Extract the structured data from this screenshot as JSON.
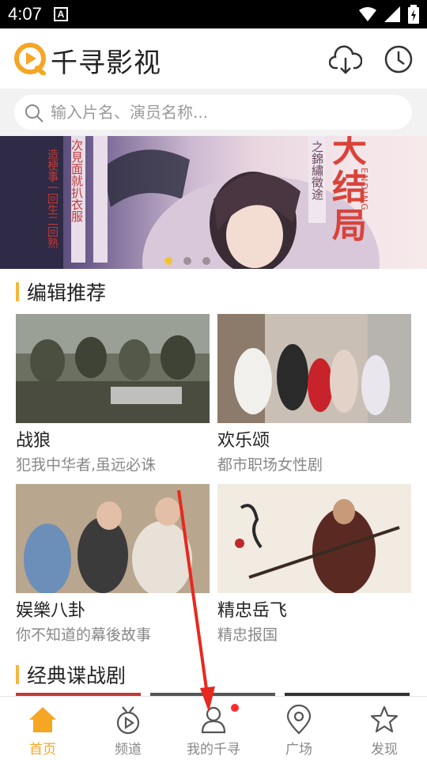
{
  "status_bar": {
    "time": "4:07",
    "notification_icon": "A"
  },
  "header": {
    "title": "千寻影视",
    "icons": [
      "logo-icon",
      "cloud-download-icon",
      "clock-icon"
    ]
  },
  "search": {
    "placeholder": "输入片名、演员名称..."
  },
  "banner": {
    "slides": 3,
    "active_slide": 1,
    "texts": [
      "大结局",
      "ENDING",
      "之錦繡徵途",
      "次見面就扒衣服",
      "造梗事一回生二回熟"
    ]
  },
  "sections": [
    {
      "title": "编辑推荐",
      "items": [
        {
          "title": "战狼",
          "subtitle": "犯我中华者,虽远必诛"
        },
        {
          "title": "欢乐颂",
          "subtitle": "都市职场女性剧"
        },
        {
          "title": "娱樂八卦",
          "subtitle": "你不知道的幕後故事"
        },
        {
          "title": "精忠岳飞",
          "subtitle": "精忠报国"
        }
      ]
    },
    {
      "title": "经典谍战剧"
    }
  ],
  "bottom_nav": [
    {
      "label": "首页",
      "icon": "home-icon",
      "active": true
    },
    {
      "label": "频道",
      "icon": "tv-icon",
      "active": false
    },
    {
      "label": "我的千寻",
      "icon": "user-icon",
      "active": false,
      "badge": true
    },
    {
      "label": "广场",
      "icon": "location-pin-icon",
      "active": false
    },
    {
      "label": "发现",
      "icon": "star-icon",
      "active": false
    }
  ],
  "colors": {
    "accent": "#f5a623",
    "section_bar": "#f5b63c",
    "badge": "#ff2a2a",
    "annotation_arrow": "#e8281e"
  }
}
